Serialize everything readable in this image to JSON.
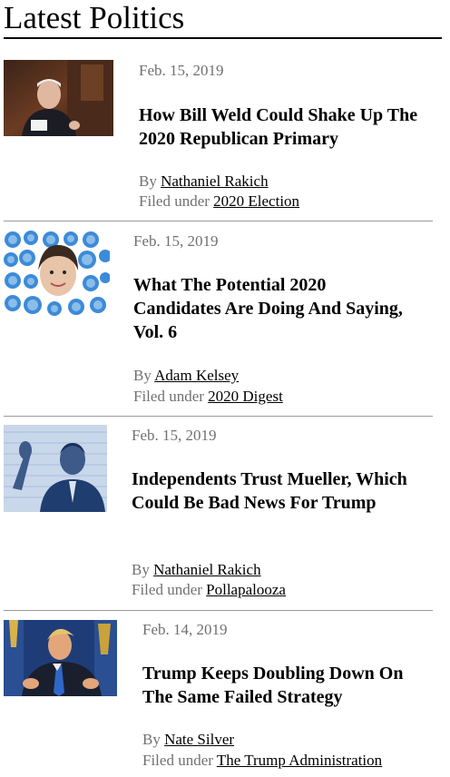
{
  "section": {
    "title": "Latest Politics"
  },
  "articles": [
    {
      "date": "Feb. 15, 2019",
      "headline": "How Bill Weld Could Shake Up The 2020 Republican Primary",
      "by_prefix": "By",
      "author": "Nathaniel Rakich",
      "filed_prefix": "Filed under",
      "category": "2020 Election",
      "thumbnail": "bill-weld-photo"
    },
    {
      "date": "Feb. 15, 2019",
      "headline": "What The Potential 2020 Candidates Are Doing And Saying, Vol. 6",
      "by_prefix": "By",
      "author": "Adam Kelsey",
      "filed_prefix": "Filed under",
      "category": "2020 Digest",
      "thumbnail": "candidates-collage"
    },
    {
      "date": "Feb. 15, 2019",
      "headline": "Independents Trust Mueller, Which Could Be Bad News For Trump",
      "by_prefix": "By",
      "author": "Nathaniel Rakich",
      "filed_prefix": "Filed under",
      "category": "Pollapalooza",
      "thumbnail": "mueller-photo"
    },
    {
      "date": "Feb. 14, 2019",
      "headline": "Trump Keeps Doubling Down On The Same Failed Strategy",
      "by_prefix": "By",
      "author": "Nate Silver",
      "filed_prefix": "Filed under",
      "category": "The Trump Administration",
      "thumbnail": "trump-photo"
    }
  ],
  "colors": {
    "text": "#000000",
    "meta": "#707070",
    "divider": "#9a9a9a"
  }
}
